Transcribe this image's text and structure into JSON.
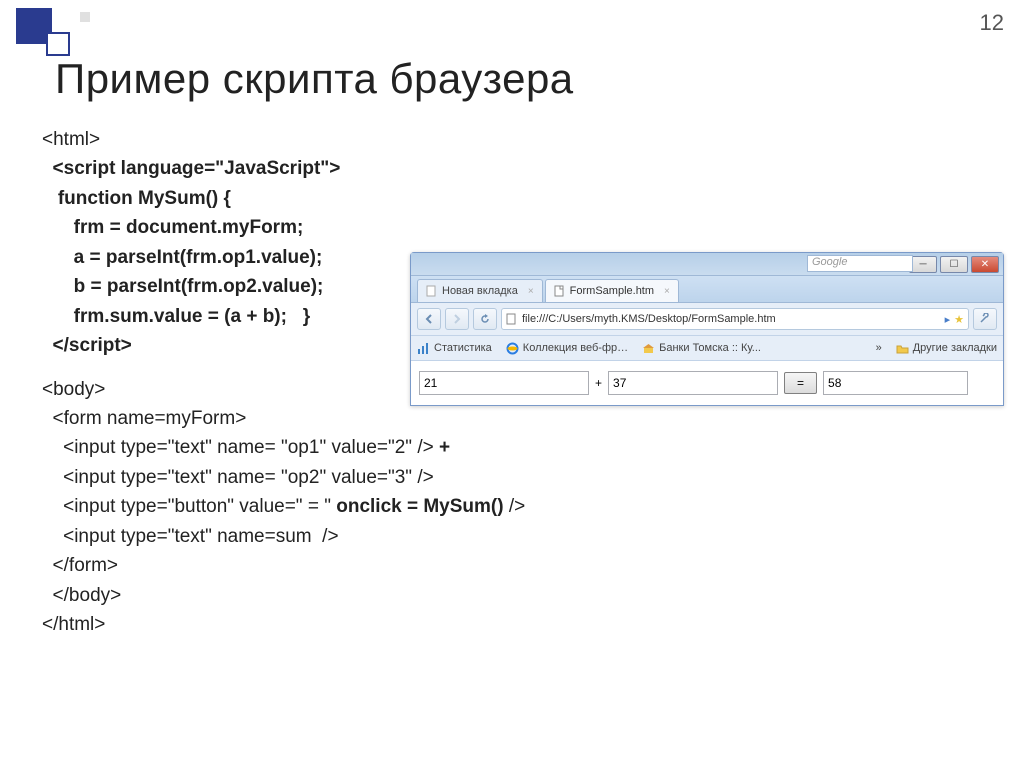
{
  "slide": {
    "number": "12",
    "title": "Пример скрипта браузера"
  },
  "code": {
    "l1": "<html>",
    "l2": "  <script language=\"JavaScript\">",
    "l3": "   function MySum() {",
    "l4": "      frm = document.myForm;",
    "l5": "      a = parseInt(frm.op1.value);",
    "l6": "      b = parseInt(frm.op2.value);",
    "l7": "      frm.sum.value = (a + b);   }",
    "l8": "  </script​>",
    "l9": "<body>",
    "l10": "  <form name=myForm>",
    "l11a": "    <input type=\"text\" name= \"op1\" value=\"2\" /> ",
    "l11b": "+",
    "l12": "    <input type=\"text\" name= \"op2\" value=\"3\" />",
    "l13a": "    <input type=\"button\" value=\" = \" ",
    "l13b": "onclick = MySum()",
    "l13c": " />",
    "l14": "    <input type=\"text\" name=sum  />",
    "l15": "  </form>",
    "l16": "  </body>",
    "l17": "</html>"
  },
  "browser": {
    "search_placeholder": "Google",
    "tabs": [
      {
        "label": "Новая вкладка",
        "active": false
      },
      {
        "label": "FormSample.htm",
        "active": true
      }
    ],
    "url": "file:///C:/Users/myth.KMS/Desktop/FormSample.htm",
    "bookmarks": {
      "b1": "Статистика",
      "b2": "Коллекция веб-фр…",
      "b3": "Банки Томска :: Ку...",
      "more": "»",
      "other": "Другие закладки"
    },
    "form": {
      "op1": "21",
      "plus": "+",
      "op2": "37",
      "eq": "=",
      "sum": "58"
    }
  }
}
